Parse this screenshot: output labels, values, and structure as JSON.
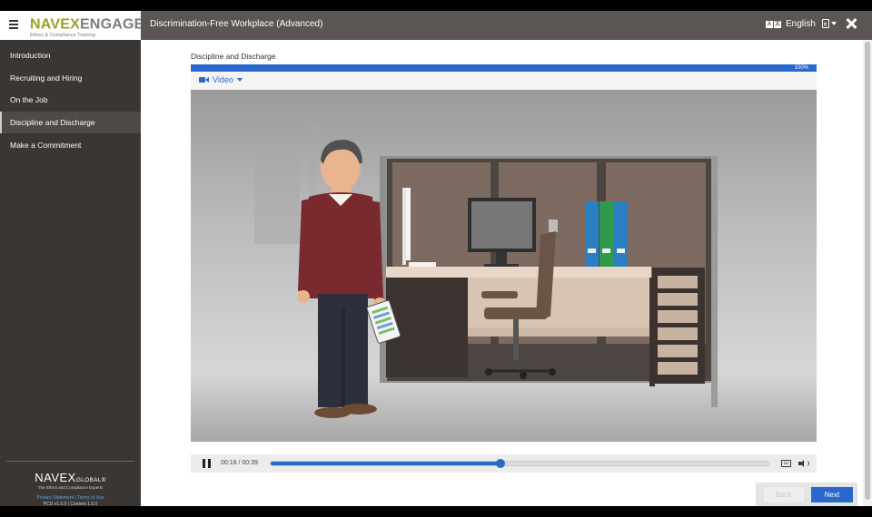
{
  "brand": {
    "logo_part1": "NAVEX",
    "logo_part2": "ENGAGE",
    "logo_reg": "®",
    "tagline": "Ethics & Compliance Training"
  },
  "header": {
    "course_title": "Discrimination-Free Workplace (Advanced)",
    "language": "English",
    "language_icon_a": "A",
    "language_icon_b": "文"
  },
  "sidebar": {
    "items": [
      {
        "label": "Introduction",
        "active": false
      },
      {
        "label": "Recruiting and Hiring",
        "active": false
      },
      {
        "label": "On the Job",
        "active": false
      },
      {
        "label": "Discipline and Discharge",
        "active": true
      },
      {
        "label": "Make a Commitment",
        "active": false
      }
    ],
    "footer": {
      "logo_main": "NAVEX",
      "logo_small": "GLOBAL",
      "logo_reg": "®",
      "tagline": "The Ethics and Compliance Experts",
      "privacy": "Privacy Statement",
      "separator": "|",
      "terms": "Terms of Use",
      "version": "PCD v1.5.0 | Content 1.0.0"
    }
  },
  "main": {
    "section_title": "Discipline and Discharge",
    "progress": {
      "value": 1.0,
      "label": "100%"
    },
    "video_tab": "Video",
    "player": {
      "time": "00:18 / 00:39",
      "played_fraction": 0.4615,
      "cc_label": "CC"
    }
  },
  "buttons": {
    "back": "Back",
    "next": "Next"
  },
  "colors": {
    "accent": "#2b68cc",
    "sidebar_bg": "#3a3633",
    "header_bg": "#5b5653",
    "logo_green": "#9aa12a"
  },
  "icons": [
    "hamburger-icon",
    "language-icon",
    "document-icon",
    "close-icon",
    "video-camera-icon",
    "pause-icon",
    "closed-captions-icon",
    "volume-icon"
  ]
}
